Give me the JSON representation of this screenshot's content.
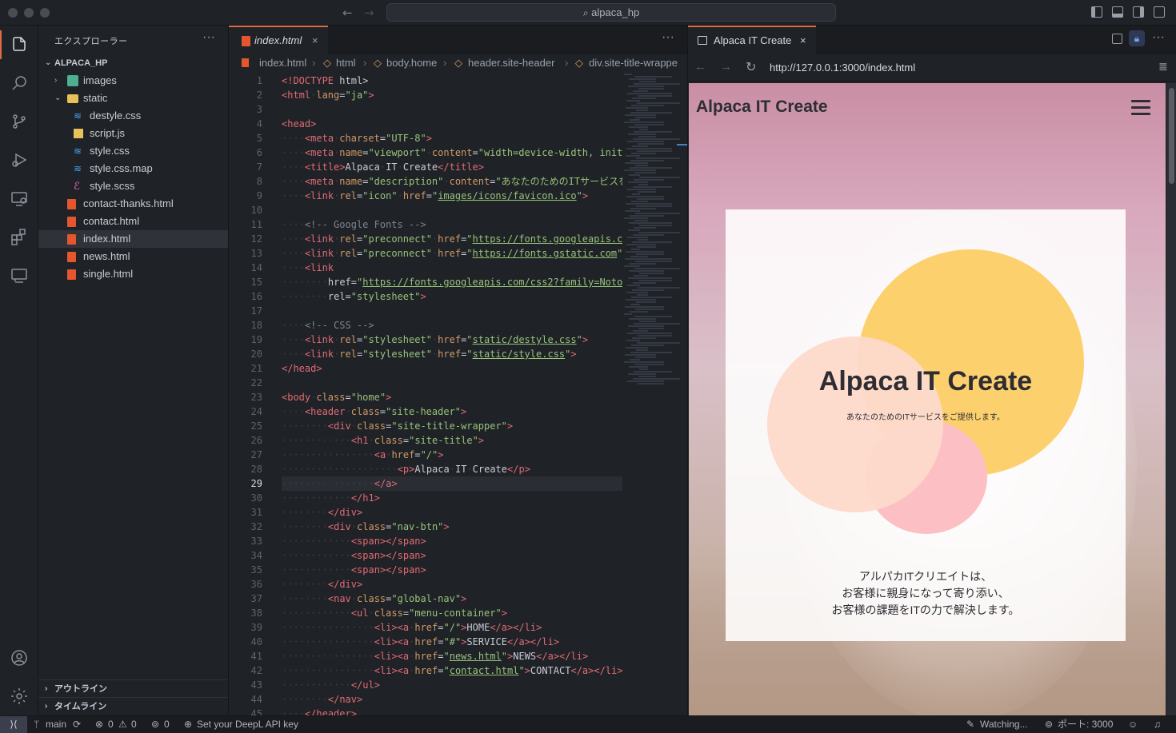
{
  "titlebar": {
    "search_text": "alpaca_hp"
  },
  "sidebar": {
    "title": "エクスプローラー",
    "more": "···",
    "root": "ALPACA_HP",
    "items": [
      {
        "label": "images",
        "kind": "folder-images"
      },
      {
        "label": "static",
        "kind": "folder-open"
      },
      {
        "label": "destyle.css",
        "kind": "css"
      },
      {
        "label": "script.js",
        "kind": "js"
      },
      {
        "label": "style.css",
        "kind": "css"
      },
      {
        "label": "style.css.map",
        "kind": "map"
      },
      {
        "label": "style.scss",
        "kind": "scss"
      },
      {
        "label": "contact-thanks.html",
        "kind": "html"
      },
      {
        "label": "contact.html",
        "kind": "html"
      },
      {
        "label": "index.html",
        "kind": "html"
      },
      {
        "label": "news.html",
        "kind": "html"
      },
      {
        "label": "single.html",
        "kind": "html"
      }
    ],
    "outline": "アウトライン",
    "timeline": "タイムライン"
  },
  "editor": {
    "tab_label": "index.html",
    "more": "···",
    "breadcrumb": [
      "index.html",
      "html",
      "body.home",
      "header.site-header",
      "div.site-title-wrappe"
    ],
    "current_line": 29,
    "line_numbers": [
      "1",
      "2",
      "3",
      "4",
      "5",
      "6",
      "7",
      "8",
      "9",
      "10",
      "11",
      "12",
      "13",
      "14",
      "15",
      "16",
      "17",
      "18",
      "19",
      "20",
      "21",
      "22",
      "23",
      "24",
      "25",
      "26",
      "27",
      "28",
      "29",
      "30",
      "31",
      "32",
      "33",
      "34",
      "35",
      "36",
      "37",
      "38",
      "39",
      "40",
      "41",
      "42",
      "43",
      "44",
      "45"
    ],
    "lines": [
      "<!DOCTYPE html>",
      "<html lang=\"ja\">",
      "",
      "<head>",
      "    <meta charset=\"UTF-8\">",
      "    <meta name=\"viewport\" content=\"width=device-width, init",
      "    <title>Alpaca IT Create</title>",
      "    <meta name=\"description\" content=\"あなたのためのITサービスを",
      "    <link rel=\"icon\" href=\"images/icons/favicon.ico\">",
      "",
      "    <!-- Google Fonts -->",
      "    <link rel=\"preconnect\" href=\"https://fonts.googleapis.c",
      "    <link rel=\"preconnect\" href=\"https://fonts.gstatic.com\"",
      "    <link",
      "        href=\"https://fonts.googleapis.com/css2?family=Noto",
      "        rel=\"stylesheet\">",
      "",
      "    <!-- CSS -->",
      "    <link rel=\"stylesheet\" href=\"static/destyle.css\">",
      "    <link rel=\"stylesheet\" href=\"static/style.css\">",
      "</head>",
      "",
      "<body class=\"home\">",
      "    <header class=\"site-header\">",
      "        <div class=\"site-title-wrapper\">",
      "            <h1 class=\"site-title\">",
      "                <a href=\"/\">",
      "                    <p>Alpaca IT Create</p>",
      "                </a>",
      "            </h1>",
      "        </div>",
      "        <div class=\"nav-btn\">",
      "            <span></span>",
      "            <span></span>",
      "            <span></span>",
      "        </div>",
      "        <nav class=\"global-nav\">",
      "            <ul class=\"menu-container\">",
      "                <li><a href=\"/\">HOME</a></li>",
      "                <li><a href=\"#\">SERVICE</a></li>",
      "                <li><a href=\"news.html\">NEWS</a></li>",
      "                <li><a href=\"contact.html\">CONTACT</a></li>",
      "            </ul>",
      "        </nav>",
      "    </header>"
    ]
  },
  "browser": {
    "tab_label": "Alpaca IT Create",
    "url": "http://127.0.0.1:3000/index.html",
    "site_title": "Alpaca IT Create",
    "hero_title": "Alpaca IT Create",
    "hero_subtitle": "あなたのためのITサービスをご提供します。",
    "hero_text": [
      "アルパカITクリエイトは、",
      "お客様に親身になって寄り添い、",
      "お客様の課題をITの力で解決します。"
    ]
  },
  "statusbar": {
    "branch": "main",
    "errors": "0",
    "warnings": "0",
    "ports_count": "0",
    "deepl": "Set your DeepL API key",
    "watching": "Watching...",
    "port": "ポート: 3000"
  },
  "colors": {
    "accent": "#e06c47",
    "tag": "#e06c75",
    "attr": "#d19a66",
    "string": "#98c379",
    "circle_yellow": "#fdd06e",
    "circle_peach": "#fddacb",
    "circle_pink": "#fcc0c4"
  }
}
